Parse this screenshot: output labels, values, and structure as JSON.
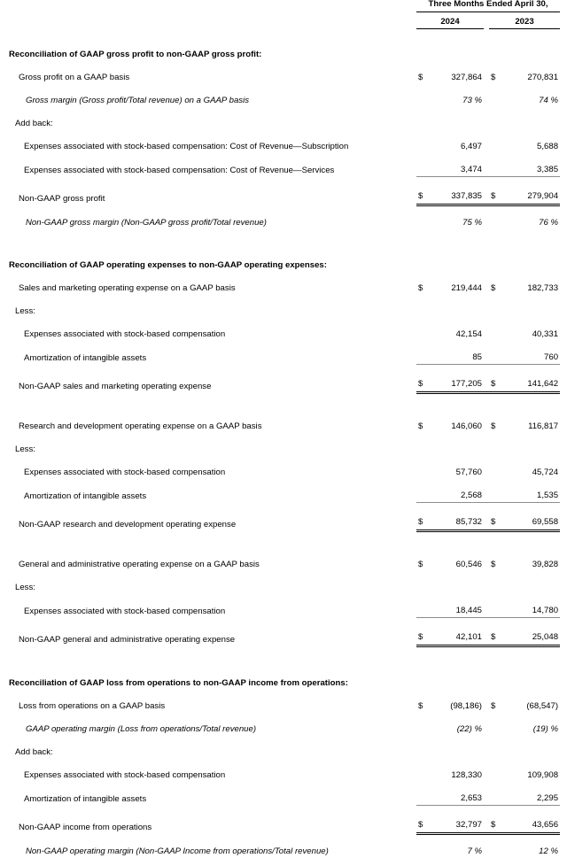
{
  "header": {
    "period_title": "Three Months Ended April 30,",
    "year_current": "2024",
    "year_prior": "2023"
  },
  "symbols": {
    "currency": "$",
    "percent": "%"
  },
  "sections": [
    {
      "id": "gross-profit",
      "title": "Reconciliation of GAAP gross profit to non-GAAP gross profit:",
      "rows": [
        {
          "label": "Gross profit on a GAAP basis",
          "cur_2024": "$",
          "v2024": "327,864",
          "cur_2023": "$",
          "v2023": "270,831"
        },
        {
          "label": "Gross margin (Gross profit/Total revenue) on a GAAP basis",
          "v2024": "73",
          "v2023": "74"
        },
        {
          "label": "Add back:"
        },
        {
          "label": "Expenses associated with stock-based compensation: Cost of Revenue—Subscription",
          "v2024": "6,497",
          "v2023": "5,688"
        },
        {
          "label": "Expenses associated with stock-based compensation: Cost of Revenue—Services",
          "v2024": "3,474",
          "v2023": "3,385"
        },
        {
          "label": "Non-GAAP gross profit",
          "cur_2024": "$",
          "v2024": "337,835",
          "cur_2023": "$",
          "v2023": "279,904"
        },
        {
          "label": "Non-GAAP gross margin (Non-GAAP gross profit/Total revenue)",
          "v2024": "75",
          "v2023": "76"
        }
      ]
    },
    {
      "id": "operating-expenses",
      "title": "Reconciliation of GAAP operating expenses to non-GAAP operating expenses:",
      "rows": [
        {
          "label": "Sales and marketing operating expense on a GAAP basis",
          "cur_2024": "$",
          "v2024": "219,444",
          "cur_2023": "$",
          "v2023": "182,733"
        },
        {
          "label": "Less:"
        },
        {
          "label": "Expenses associated with stock-based compensation",
          "v2024": "42,154",
          "v2023": "40,331"
        },
        {
          "label": "Amortization of intangible assets",
          "v2024": "85",
          "v2023": "760"
        },
        {
          "label": "Non-GAAP sales and marketing operating expense",
          "cur_2024": "$",
          "v2024": "177,205",
          "cur_2023": "$",
          "v2023": "141,642"
        },
        {
          "label": "Research and development operating expense on a GAAP basis",
          "cur_2024": "$",
          "v2024": "146,060",
          "cur_2023": "$",
          "v2023": "116,817"
        },
        {
          "label": "Less:"
        },
        {
          "label": "Expenses associated with stock-based compensation",
          "v2024": "57,760",
          "v2023": "45,724"
        },
        {
          "label": "Amortization of intangible assets",
          "v2024": "2,568",
          "v2023": "1,535"
        },
        {
          "label": "Non-GAAP research and development operating expense",
          "cur_2024": "$",
          "v2024": "85,732",
          "cur_2023": "$",
          "v2023": "69,558"
        },
        {
          "label": "General and administrative operating expense on a GAAP basis",
          "cur_2024": "$",
          "v2024": "60,546",
          "cur_2023": "$",
          "v2023": "39,828"
        },
        {
          "label": "Less:"
        },
        {
          "label": "Expenses associated with stock-based compensation",
          "v2024": "18,445",
          "v2023": "14,780"
        },
        {
          "label": "Non-GAAP general and administrative operating expense",
          "cur_2024": "$",
          "v2024": "42,101",
          "cur_2023": "$",
          "v2023": "25,048"
        }
      ]
    },
    {
      "id": "income-from-operations",
      "title": "Reconciliation of GAAP loss from operations to non-GAAP income from operations:",
      "rows": [
        {
          "label": "Loss from operations on a GAAP basis",
          "cur_2024": "$",
          "v2024": "(98,186)",
          "cur_2023": "$",
          "v2023": "(68,547)"
        },
        {
          "label": "GAAP operating margin (Loss from operations/Total revenue)",
          "v2024": "(22)",
          "v2023": "(19)"
        },
        {
          "label": "Add back:"
        },
        {
          "label": "Expenses associated with stock-based compensation",
          "v2024": "128,330",
          "v2023": "109,908"
        },
        {
          "label": "Amortization of intangible assets",
          "v2024": "2,653",
          "v2023": "2,295"
        },
        {
          "label": "Non-GAAP income from operations",
          "cur_2024": "$",
          "v2024": "32,797",
          "cur_2023": "$",
          "v2023": "43,656"
        },
        {
          "label": "Non-GAAP operating margin (Non-GAAP Income from operations/Total revenue)",
          "v2024": "7",
          "v2023": "12"
        }
      ]
    }
  ]
}
